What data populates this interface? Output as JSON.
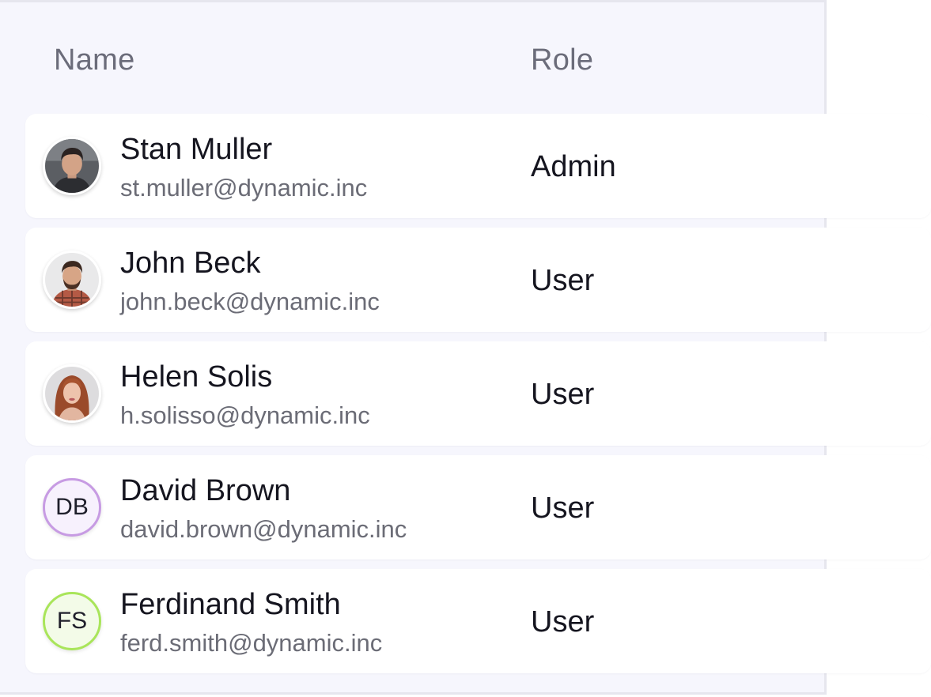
{
  "table": {
    "headers": {
      "name": "Name",
      "role": "Role"
    },
    "rows": [
      {
        "name": "Stan Muller",
        "email": "st.muller@dynamic.inc",
        "role": "Admin",
        "avatar": "photo-man-dark-hair"
      },
      {
        "name": "John Beck",
        "email": "john.beck@dynamic.inc",
        "role": "User",
        "avatar": "photo-man-beard-plaid"
      },
      {
        "name": "Helen Solis",
        "email": "h.solisso@dynamic.inc",
        "role": "User",
        "avatar": "photo-woman-auburn-hair"
      },
      {
        "name": "David Brown",
        "email": "david.brown@dynamic.inc",
        "role": "User",
        "initials": "DB",
        "avatar_border": "#c79be3",
        "avatar_bg": "#f7f1fd"
      },
      {
        "name": "Ferdinand Smith",
        "email": "ferd.smith@dynamic.inc",
        "role": "User",
        "initials": "FS",
        "avatar_border": "#a9e55a",
        "avatar_bg": "#f3fbe8"
      }
    ]
  },
  "colors": {
    "panel_bg": "#f6f6fd",
    "row_bg": "#ffffff",
    "header_text": "#6b6c7a",
    "primary_text": "#15151f",
    "secondary_text": "#6b6c76"
  }
}
